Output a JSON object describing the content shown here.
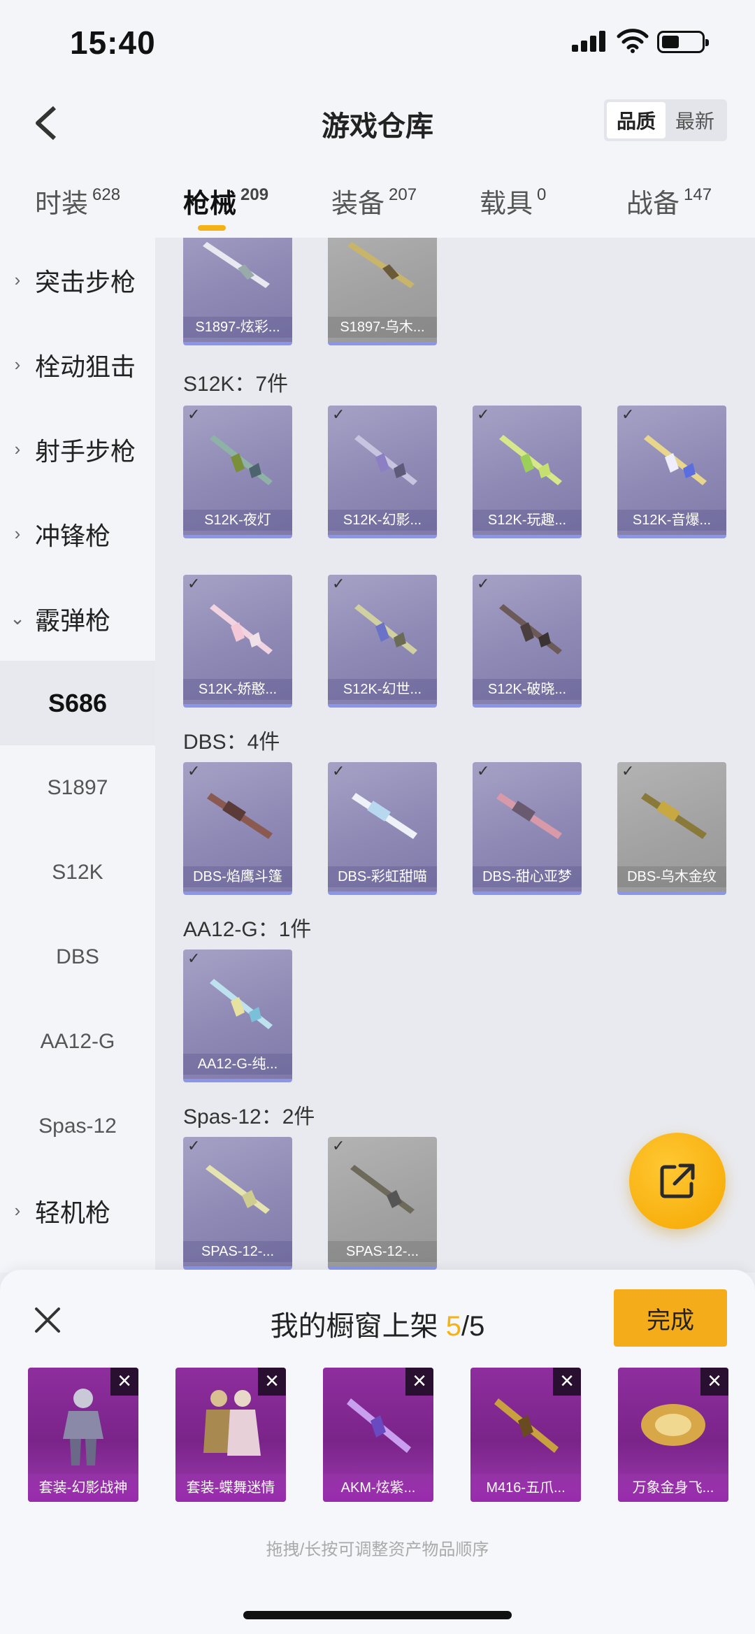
{
  "status": {
    "time": "15:40"
  },
  "header": {
    "title": "游戏仓库",
    "sort_options": [
      "品质",
      "最新"
    ]
  },
  "tabs": [
    {
      "label": "时装",
      "count": "628"
    },
    {
      "label": "枪械",
      "count": "209"
    },
    {
      "label": "装备",
      "count": "207"
    },
    {
      "label": "载具",
      "count": "0"
    },
    {
      "label": "战备",
      "count": "147"
    }
  ],
  "sidebar": {
    "categories": [
      "突击步枪",
      "栓动狙击",
      "射手步枪",
      "冲锋枪",
      "霰弹枪",
      "轻机枪"
    ],
    "subitems": [
      "S686",
      "S1897",
      "S12K",
      "DBS",
      "AA12-G",
      "Spas-12"
    ]
  },
  "content": {
    "s1897_items": [
      "S1897-炫彩...",
      "S1897-乌木..."
    ],
    "s12k": {
      "title": "S12K：7件",
      "items": [
        "S12K-夜灯",
        "S12K-幻影...",
        "S12K-玩趣...",
        "S12K-音爆...",
        "S12K-娇憨...",
        "S12K-幻世...",
        "S12K-破晓..."
      ]
    },
    "dbs": {
      "title": "DBS：4件",
      "items": [
        "DBS-焰鹰斗篷",
        "DBS-彩虹甜喵",
        "DBS-甜心亚梦",
        "DBS-乌木金纹"
      ]
    },
    "aa12": {
      "title": "AA12-G：1件",
      "items": [
        "AA12-G-纯..."
      ]
    },
    "spas": {
      "title": "Spas-12：2件",
      "items": [
        "SPAS-12-...",
        "SPAS-12-..."
      ]
    }
  },
  "sheet": {
    "title": "我的橱窗上架",
    "count": "5",
    "total": "/5",
    "done_label": "完成",
    "slots": [
      "套装-幻影战神",
      "套装-蝶舞迷情",
      "AKM-炫紫...",
      "M416-五爪...",
      "万象金身飞..."
    ],
    "hint": "拖拽/长按可调整资产物品顺序"
  },
  "colors": {
    "accent": "#f4b214",
    "done_button": "#f4ac1b",
    "card_purple": "#8c87b3",
    "slot_purple": "#8e2e9e"
  },
  "icons": [
    "back-icon",
    "close-icon",
    "share-icon",
    "check-icon",
    "chevron-right-icon",
    "chevron-down-icon"
  ]
}
